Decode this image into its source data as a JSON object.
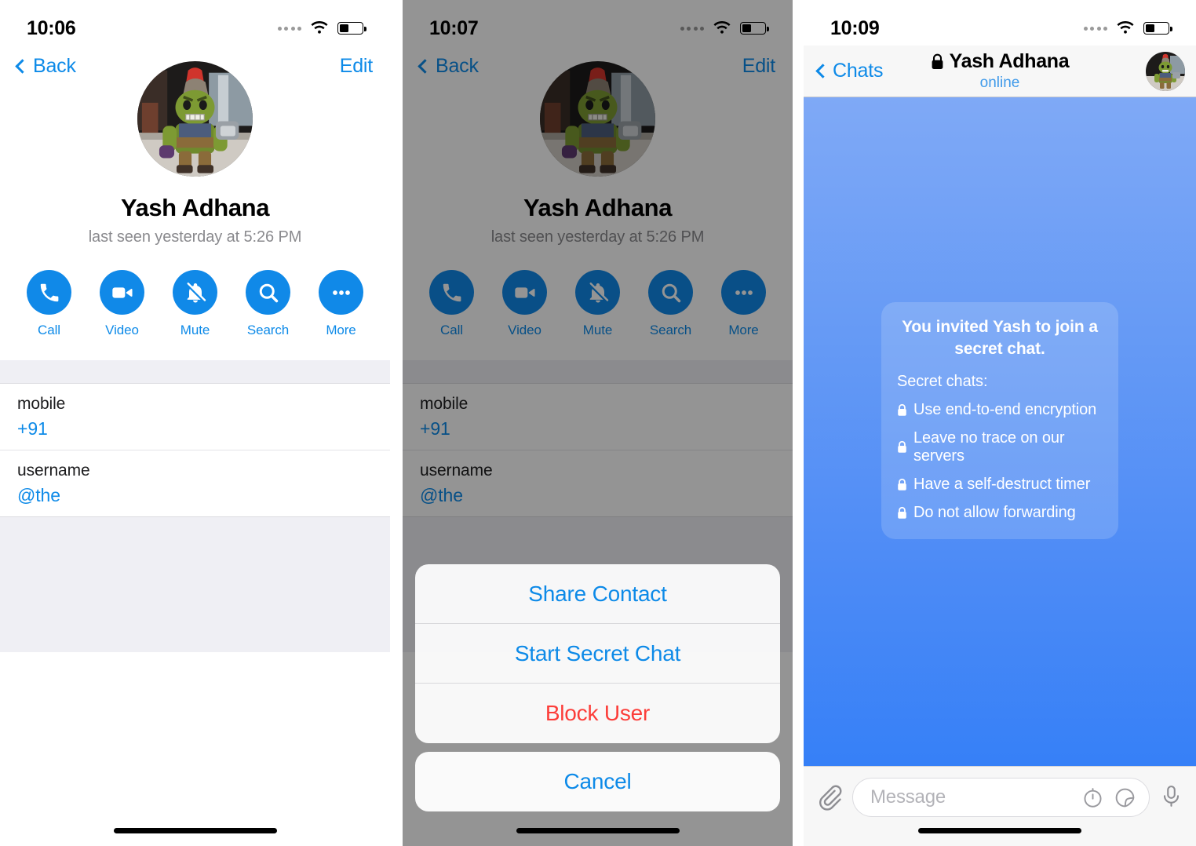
{
  "app": "Telegram iOS",
  "panels": [
    {
      "id": "contact-profile",
      "statusbar": {
        "time": "10:06",
        "signal_icon": "signal-dots-icon",
        "wifi_icon": "wifi-icon",
        "battery_icon": "battery-icon"
      },
      "nav": {
        "back_label": "Back",
        "edit_label": "Edit"
      },
      "profile": {
        "avatar_icon": "contact-avatar",
        "name": "Yash Adhana",
        "status": "last seen yesterday at 5:26 PM"
      },
      "actions": [
        {
          "label": "Call",
          "icon": "phone-icon"
        },
        {
          "label": "Video",
          "icon": "video-camera-icon"
        },
        {
          "label": "Mute",
          "icon": "bell-slash-icon"
        },
        {
          "label": "Search",
          "icon": "search-icon"
        },
        {
          "label": "More",
          "icon": "ellipsis-icon"
        }
      ],
      "info_rows": [
        {
          "label": "mobile",
          "value": "+91"
        },
        {
          "label": "username",
          "value": "@the"
        }
      ]
    },
    {
      "id": "contact-profile-action-sheet",
      "statusbar": {
        "time": "10:07",
        "signal_icon": "signal-dots-icon",
        "wifi_icon": "wifi-icon",
        "battery_icon": "battery-icon"
      },
      "nav": {
        "back_label": "Back",
        "edit_label": "Edit"
      },
      "profile": {
        "avatar_icon": "contact-avatar",
        "name": "Yash Adhana",
        "status": "last seen yesterday at 5:26 PM"
      },
      "actions": [
        {
          "label": "Call",
          "icon": "phone-icon"
        },
        {
          "label": "Video",
          "icon": "video-camera-icon"
        },
        {
          "label": "Mute",
          "icon": "bell-slash-icon"
        },
        {
          "label": "Search",
          "icon": "search-icon"
        },
        {
          "label": "More",
          "icon": "ellipsis-icon"
        }
      ],
      "info_rows": [
        {
          "label": "mobile",
          "value": "+91"
        },
        {
          "label": "username",
          "value": "@the"
        }
      ],
      "action_sheet": {
        "items": [
          {
            "label": "Share Contact",
            "style": "default"
          },
          {
            "label": "Start Secret Chat",
            "style": "default"
          },
          {
            "label": "Block User",
            "style": "destructive"
          }
        ],
        "cancel_label": "Cancel"
      }
    },
    {
      "id": "secret-chat",
      "statusbar": {
        "time": "10:09",
        "signal_icon": "signal-dots-icon",
        "wifi_icon": "wifi-icon",
        "battery_icon": "battery-icon"
      },
      "nav": {
        "back_label": "Chats",
        "title": "Yash Adhana",
        "title_lock_icon": "lock-icon",
        "status": "online",
        "avatar_icon": "contact-avatar"
      },
      "bubble": {
        "title": "You invited Yash to join a secret chat.",
        "subtitle": "Secret chats:",
        "items": [
          "Use end-to-end encryption",
          "Leave no trace on our servers",
          "Have a self-destruct timer",
          "Do not allow forwarding"
        ],
        "item_icon": "lock-icon"
      },
      "input_bar": {
        "attach_icon": "paperclip-icon",
        "placeholder": "Message",
        "timer_icon": "self-destruct-timer-icon",
        "sticker_icon": "sticker-icon",
        "mic_icon": "microphone-icon"
      }
    }
  ],
  "colors": {
    "accent_blue": "#0d8ae8",
    "action_circle_blue": "#1089e8",
    "destructive_red": "#fc3d39",
    "grouped_bg": "#efeff4",
    "chat_gradient_top": "#7fa9f6",
    "chat_gradient_bottom": "#3680f7"
  }
}
